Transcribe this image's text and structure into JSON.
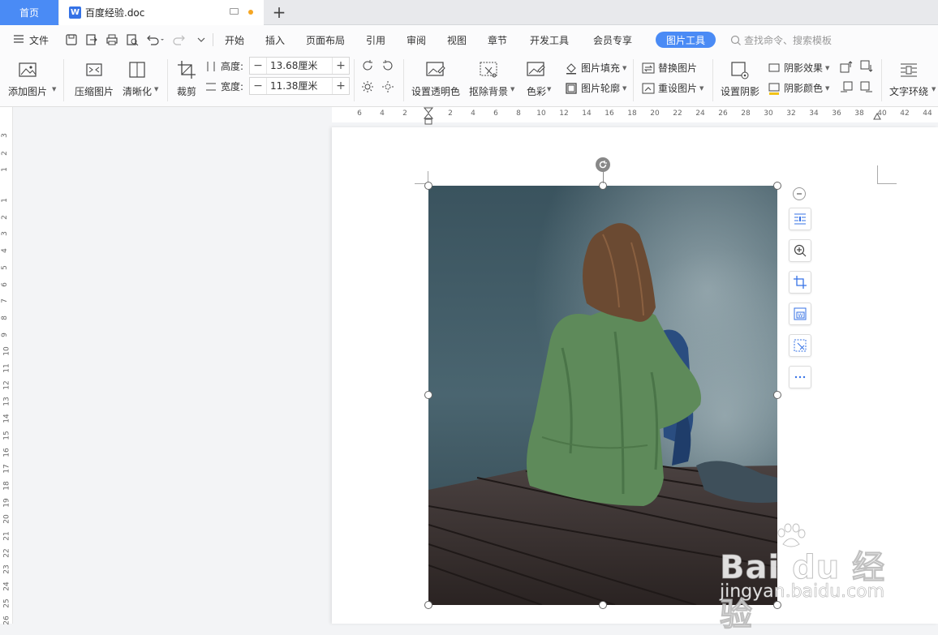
{
  "titlebar": {
    "home_tab": "首页",
    "doc_title": "百度经验.doc",
    "new_tab": "+"
  },
  "menubar": {
    "file": "文件",
    "tabs": [
      "开始",
      "插入",
      "页面布局",
      "引用",
      "审阅",
      "视图",
      "章节",
      "开发工具",
      "会员专享"
    ],
    "active_tab": "图片工具",
    "search_placeholder": "查找命令、搜索模板"
  },
  "ribbon": {
    "add_picture": "添加图片",
    "compress": "压缩图片",
    "sharpen": "清晰化",
    "crop": "裁剪",
    "height_label": "高度:",
    "height_value": "13.68厘米",
    "width_label": "宽度:",
    "width_value": "11.38厘米",
    "set_transparent": "设置透明色",
    "remove_bg": "抠除背景",
    "color": "色彩",
    "picture_fill": "图片填充",
    "picture_outline": "图片轮廓",
    "replace_picture": "替换图片",
    "reset_picture": "重设图片",
    "set_shadow": "设置阴影",
    "shadow_effect": "阴影效果",
    "shadow_color": "阴影颜色",
    "text_wrap": "文字环绕"
  },
  "ruler": {
    "h_labels": [
      "6",
      "4",
      "2",
      "2",
      "4",
      "6",
      "8",
      "10",
      "12",
      "14",
      "16",
      "18",
      "20",
      "22",
      "24",
      "26",
      "28",
      "30",
      "32",
      "34",
      "36",
      "38",
      "40",
      "42",
      "44"
    ],
    "v_labels_top": [
      "3",
      "2",
      "1"
    ],
    "v_labels": [
      "1",
      "2",
      "3",
      "4",
      "5",
      "6",
      "7",
      "8",
      "9",
      "10",
      "11",
      "12",
      "13",
      "14",
      "15",
      "16",
      "17",
      "18",
      "19",
      "20",
      "21",
      "22",
      "23",
      "24",
      "25",
      "26"
    ]
  },
  "watermark": {
    "brand": "Bai du 经验",
    "url": "jingyan.baidu.com"
  },
  "colors": {
    "accent": "#4a8bf5",
    "jacket": "#5e8a5a",
    "water": "#3e5560",
    "dock": "#3a3330"
  }
}
